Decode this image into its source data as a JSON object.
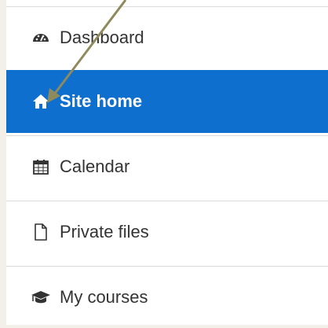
{
  "nav": {
    "items": [
      {
        "label": "Dashboard",
        "icon": "dashboard-icon",
        "active": false
      },
      {
        "label": "Site home",
        "icon": "home-icon",
        "active": true
      },
      {
        "label": "Calendar",
        "icon": "calendar-icon",
        "active": false
      },
      {
        "label": "Private files",
        "icon": "file-icon",
        "active": false
      },
      {
        "label": "My courses",
        "icon": "graduation-cap-icon",
        "active": false
      }
    ]
  },
  "colors": {
    "active_bg": "#0f6fcf",
    "arrow": "#8f8a5c",
    "page_bg": "#f3f0ea"
  }
}
